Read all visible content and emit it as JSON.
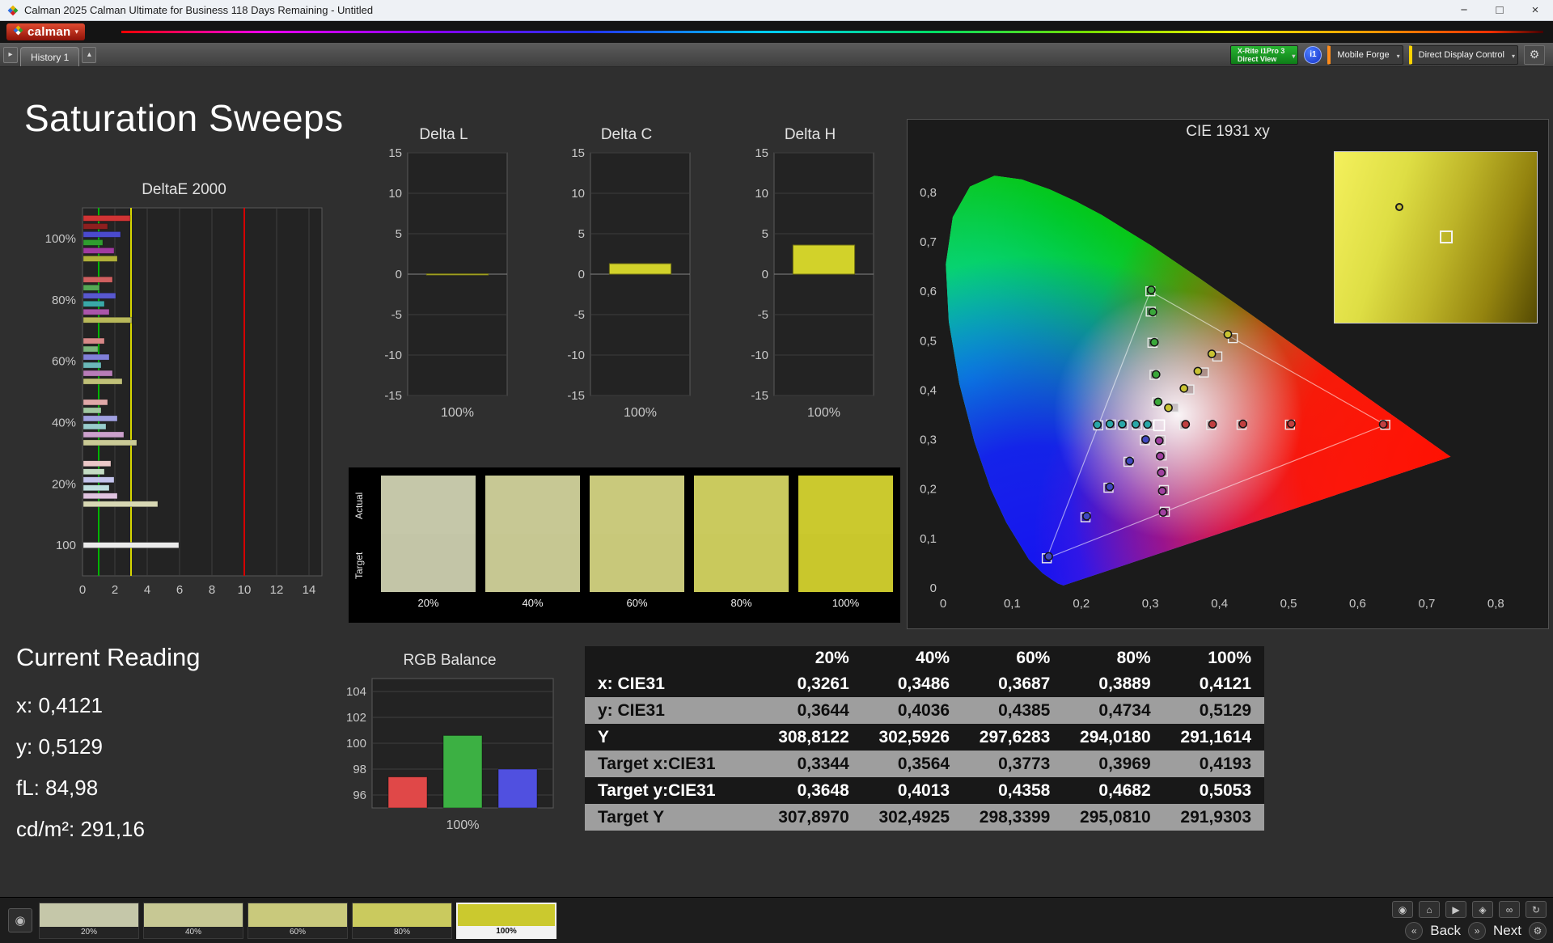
{
  "window": {
    "title": "Calman 2025 Calman Ultimate for Business 118 Days Remaining  - Untitled"
  },
  "brand": {
    "logo_text": "calman"
  },
  "icons": {
    "minimize": "−",
    "maximize": "□",
    "close": "×",
    "caret_down": "▾",
    "expander": "▸",
    "history_up": "▴",
    "gear": "⚙",
    "rewind": "«",
    "forward": "»",
    "eye": "◉"
  },
  "toolbar": {
    "history_tab": "History 1",
    "meter_line1": "X-Rite i1Pro 3",
    "meter_line2": "Direct View",
    "meter_badge": "i1",
    "source_label": "Mobile Forge",
    "display_label": "Direct Display Control"
  },
  "page": {
    "title": "Saturation Sweeps"
  },
  "current_reading": {
    "title": "Current Reading",
    "lines": [
      "x: 0,4121",
      "y: 0,5129",
      "fL: 84,98",
      "cd/m²: 291,16"
    ]
  },
  "swatches": {
    "row_labels": [
      "Actual",
      "Target"
    ],
    "labels": [
      "20%",
      "40%",
      "60%",
      "80%",
      "100%"
    ],
    "actual": [
      "#c5c7a9",
      "#c7c894",
      "#c9c97c",
      "#caca5e",
      "#cbc92e"
    ],
    "target": [
      "#c3c5a7",
      "#c6c792",
      "#c8c87a",
      "#c9c95c",
      "#c9c72c"
    ]
  },
  "table": {
    "columns": [
      "20%",
      "40%",
      "60%",
      "80%",
      "100%"
    ],
    "rows": [
      {
        "label": "x: CIE31",
        "shade": "dark",
        "values": [
          "0,3261",
          "0,3486",
          "0,3687",
          "0,3889",
          "0,4121"
        ]
      },
      {
        "label": "y: CIE31",
        "shade": "light",
        "values": [
          "0,3644",
          "0,4036",
          "0,4385",
          "0,4734",
          "0,5129"
        ]
      },
      {
        "label": "Y",
        "shade": "dark",
        "values": [
          "308,8122",
          "302,5926",
          "297,6283",
          "294,0180",
          "291,1614"
        ]
      },
      {
        "label": "Target x:CIE31",
        "shade": "light",
        "values": [
          "0,3344",
          "0,3564",
          "0,3773",
          "0,3969",
          "0,4193"
        ]
      },
      {
        "label": "Target y:CIE31",
        "shade": "dark",
        "values": [
          "0,3648",
          "0,4013",
          "0,4358",
          "0,4682",
          "0,5053"
        ]
      },
      {
        "label": "Target Y",
        "shade": "light",
        "values": [
          "307,8970",
          "302,4925",
          "298,3399",
          "295,0810",
          "291,9303"
        ]
      }
    ]
  },
  "bottombar": {
    "back_label": "Back",
    "next_label": "Next",
    "selected_index": 4,
    "thumbnails": [
      {
        "label": "20%",
        "color": "#c5c7a9"
      },
      {
        "label": "40%",
        "color": "#c7c894"
      },
      {
        "label": "60%",
        "color": "#c9c97c"
      },
      {
        "label": "80%",
        "color": "#caca5e"
      },
      {
        "label": "100%",
        "color": "#cbc92e"
      }
    ],
    "icon_buttons": [
      {
        "name": "visibility",
        "glyph": "◉"
      },
      {
        "name": "home",
        "glyph": "⌂"
      },
      {
        "name": "play",
        "glyph": "▶"
      },
      {
        "name": "marker",
        "glyph": "◈"
      },
      {
        "name": "link",
        "glyph": "∞"
      },
      {
        "name": "refresh",
        "glyph": "↻"
      }
    ]
  },
  "chart_data": [
    {
      "id": "deltae",
      "type": "bar",
      "orientation": "horizontal",
      "title": "DeltaE 2000",
      "xlim": [
        0,
        14.8
      ],
      "xticks": [
        0,
        2,
        4,
        6,
        8,
        10,
        12,
        14
      ],
      "ref_lines": [
        {
          "value": 1,
          "color": "#00b400"
        },
        {
          "value": 3,
          "color": "#d6d600"
        },
        {
          "value": 10,
          "color": "#d40000"
        }
      ],
      "groups": [
        {
          "label": "100%",
          "bars": [
            {
              "value": 2.9,
              "color": "#d03434"
            },
            {
              "value": 1.5,
              "color": "#8e1f1f"
            },
            {
              "value": 2.3,
              "color": "#4a4acd"
            },
            {
              "value": 1.2,
              "color": "#2f9e2f"
            },
            {
              "value": 1.9,
              "color": "#a03aa0"
            },
            {
              "value": 2.1,
              "color": "#b0b03a"
            }
          ]
        },
        {
          "label": "80%",
          "bars": [
            {
              "value": 1.8,
              "color": "#d06060"
            },
            {
              "value": 1.0,
              "color": "#55a855"
            },
            {
              "value": 2.0,
              "color": "#5858cf"
            },
            {
              "value": 1.3,
              "color": "#3aa8a8"
            },
            {
              "value": 1.6,
              "color": "#aa55aa"
            },
            {
              "value": 3.0,
              "color": "#b8b85a"
            }
          ]
        },
        {
          "label": "60%",
          "bars": [
            {
              "value": 1.3,
              "color": "#d88888"
            },
            {
              "value": 0.9,
              "color": "#7cb47c"
            },
            {
              "value": 1.6,
              "color": "#8080d8"
            },
            {
              "value": 1.1,
              "color": "#6ab8b8"
            },
            {
              "value": 1.8,
              "color": "#b87cb8"
            },
            {
              "value": 2.4,
              "color": "#c0c078"
            }
          ]
        },
        {
          "label": "40%",
          "bars": [
            {
              "value": 1.5,
              "color": "#e0a8a8"
            },
            {
              "value": 1.1,
              "color": "#a0c8a0"
            },
            {
              "value": 2.1,
              "color": "#a0a0e0"
            },
            {
              "value": 1.4,
              "color": "#98cccc"
            },
            {
              "value": 2.5,
              "color": "#cca0cc"
            },
            {
              "value": 3.3,
              "color": "#caca96"
            }
          ]
        },
        {
          "label": "20%",
          "bars": [
            {
              "value": 1.7,
              "color": "#ecc8c8"
            },
            {
              "value": 1.3,
              "color": "#c4dcc4"
            },
            {
              "value": 1.9,
              "color": "#c4c4ec"
            },
            {
              "value": 1.6,
              "color": "#c0e0e0"
            },
            {
              "value": 2.1,
              "color": "#e0c4e0"
            },
            {
              "value": 4.6,
              "color": "#d8d8b4"
            }
          ]
        },
        {
          "label": "100",
          "bars": [
            {
              "value": 5.9,
              "color": "#ebebeb"
            }
          ]
        }
      ]
    },
    {
      "id": "deltaL",
      "type": "bar",
      "title": "Delta L",
      "ylim": [
        -15,
        15
      ],
      "yticks": [
        15,
        10,
        5,
        0,
        -5,
        -10,
        -15
      ],
      "categories": [
        "100%"
      ],
      "values": [
        0.05
      ],
      "bar_color": "#d2d22a"
    },
    {
      "id": "deltaC",
      "type": "bar",
      "title": "Delta C",
      "ylim": [
        -15,
        15
      ],
      "yticks": [
        15,
        10,
        5,
        0,
        -5,
        -10,
        -15
      ],
      "categories": [
        "100%"
      ],
      "values": [
        1.3
      ],
      "bar_color": "#d2d22a"
    },
    {
      "id": "deltaH",
      "type": "bar",
      "title": "Delta H",
      "ylim": [
        -15,
        15
      ],
      "yticks": [
        15,
        10,
        5,
        0,
        -5,
        -10,
        -15
      ],
      "categories": [
        "100%"
      ],
      "values": [
        3.6
      ],
      "bar_color": "#d2d22a"
    },
    {
      "id": "rgb",
      "type": "bar",
      "title": "RGB Balance",
      "ylim": [
        95,
        105
      ],
      "yticks": [
        104,
        102,
        100,
        98,
        96
      ],
      "categories": [
        "100%"
      ],
      "series": [
        {
          "name": "Red",
          "value": 97.4,
          "color": "#e04848"
        },
        {
          "name": "Green",
          "value": 100.6,
          "color": "#3cb043"
        },
        {
          "name": "Blue",
          "value": 98.0,
          "color": "#5050e0"
        }
      ]
    },
    {
      "id": "cie",
      "type": "scatter",
      "title": "CIE 1931 xy",
      "xlim": [
        0,
        0.85
      ],
      "ylim": [
        0,
        0.88
      ],
      "xtick_labels": [
        "0",
        "0,1",
        "0,2",
        "0,3",
        "0,4",
        "0,5",
        "0,6",
        "0,7",
        "0,8"
      ],
      "ytick_labels": [
        "0",
        "0,1",
        "0,2",
        "0,3",
        "0,4",
        "0,5",
        "0,6",
        "0,7",
        "0,8"
      ],
      "white_point": [
        0.3127,
        0.329
      ],
      "gamut_triangle": [
        [
          0.64,
          0.33
        ],
        [
          0.3,
          0.6
        ],
        [
          0.15,
          0.06
        ]
      ],
      "sweeps": [
        {
          "name": "yellow",
          "color": "#c8c232",
          "targets": [
            [
              0.3344,
              0.3648
            ],
            [
              0.3564,
              0.4013
            ],
            [
              0.3773,
              0.4358
            ],
            [
              0.3969,
              0.4682
            ],
            [
              0.4193,
              0.5053
            ]
          ],
          "measured": [
            [
              0.3261,
              0.3644
            ],
            [
              0.3486,
              0.4036
            ],
            [
              0.3687,
              0.4385
            ],
            [
              0.3889,
              0.4734
            ],
            [
              0.4121,
              0.5129
            ]
          ]
        },
        {
          "name": "red",
          "color": "#c04040",
          "targets": [
            [
              0.349,
              0.3295
            ],
            [
              0.388,
              0.3298
            ],
            [
              0.432,
              0.33
            ],
            [
              0.502,
              0.3302
            ],
            [
              0.64,
              0.33
            ]
          ],
          "measured": [
            [
              0.351,
              0.331
            ],
            [
              0.39,
              0.3312
            ],
            [
              0.434,
              0.3318
            ],
            [
              0.504,
              0.332
            ],
            [
              0.637,
              0.331
            ]
          ]
        },
        {
          "name": "green",
          "color": "#3aa83a",
          "targets": [
            [
              0.3095,
              0.3755
            ],
            [
              0.3061,
              0.431
            ],
            [
              0.303,
              0.496
            ],
            [
              0.3005,
              0.559
            ],
            [
              0.3,
              0.6
            ]
          ],
          "measured": [
            [
              0.3112,
              0.3762
            ],
            [
              0.3082,
              0.4318
            ],
            [
              0.3058,
              0.4968
            ],
            [
              0.3035,
              0.558
            ],
            [
              0.3012,
              0.6028
            ]
          ]
        },
        {
          "name": "blue",
          "color": "#4048c0",
          "targets": [
            [
              0.2921,
              0.2988
            ],
            [
              0.2683,
              0.2552
            ],
            [
              0.2394,
              0.2028
            ],
            [
              0.2061,
              0.143
            ],
            [
              0.15,
              0.06
            ]
          ],
          "measured": [
            [
              0.2932,
              0.3002
            ],
            [
              0.2701,
              0.2568
            ],
            [
              0.2412,
              0.2046
            ],
            [
              0.2078,
              0.1452
            ],
            [
              0.1528,
              0.0638
            ]
          ]
        },
        {
          "name": "cyan",
          "color": "#2aa8a8",
          "targets": [
            [
              0.2977,
              0.3293
            ],
            [
              0.2806,
              0.3296
            ],
            [
              0.2608,
              0.33
            ],
            [
              0.243,
              0.3305
            ],
            [
              0.2246,
              0.3288
            ]
          ],
          "measured": [
            [
              0.2958,
              0.3308
            ],
            [
              0.2788,
              0.3312
            ],
            [
              0.2592,
              0.3315
            ],
            [
              0.2415,
              0.3318
            ],
            [
              0.2232,
              0.3302
            ]
          ]
        },
        {
          "name": "magenta",
          "color": "#a040a0",
          "targets": [
            [
              0.3146,
              0.299
            ],
            [
              0.3163,
              0.268
            ],
            [
              0.318,
              0.235
            ],
            [
              0.3196,
              0.198
            ],
            [
              0.3209,
              0.1542
            ]
          ],
          "measured": [
            [
              0.3128,
              0.2978
            ],
            [
              0.3142,
              0.2665
            ],
            [
              0.3158,
              0.2332
            ],
            [
              0.3172,
              0.1962
            ],
            [
              0.3185,
              0.1528
            ]
          ]
        }
      ]
    }
  ]
}
